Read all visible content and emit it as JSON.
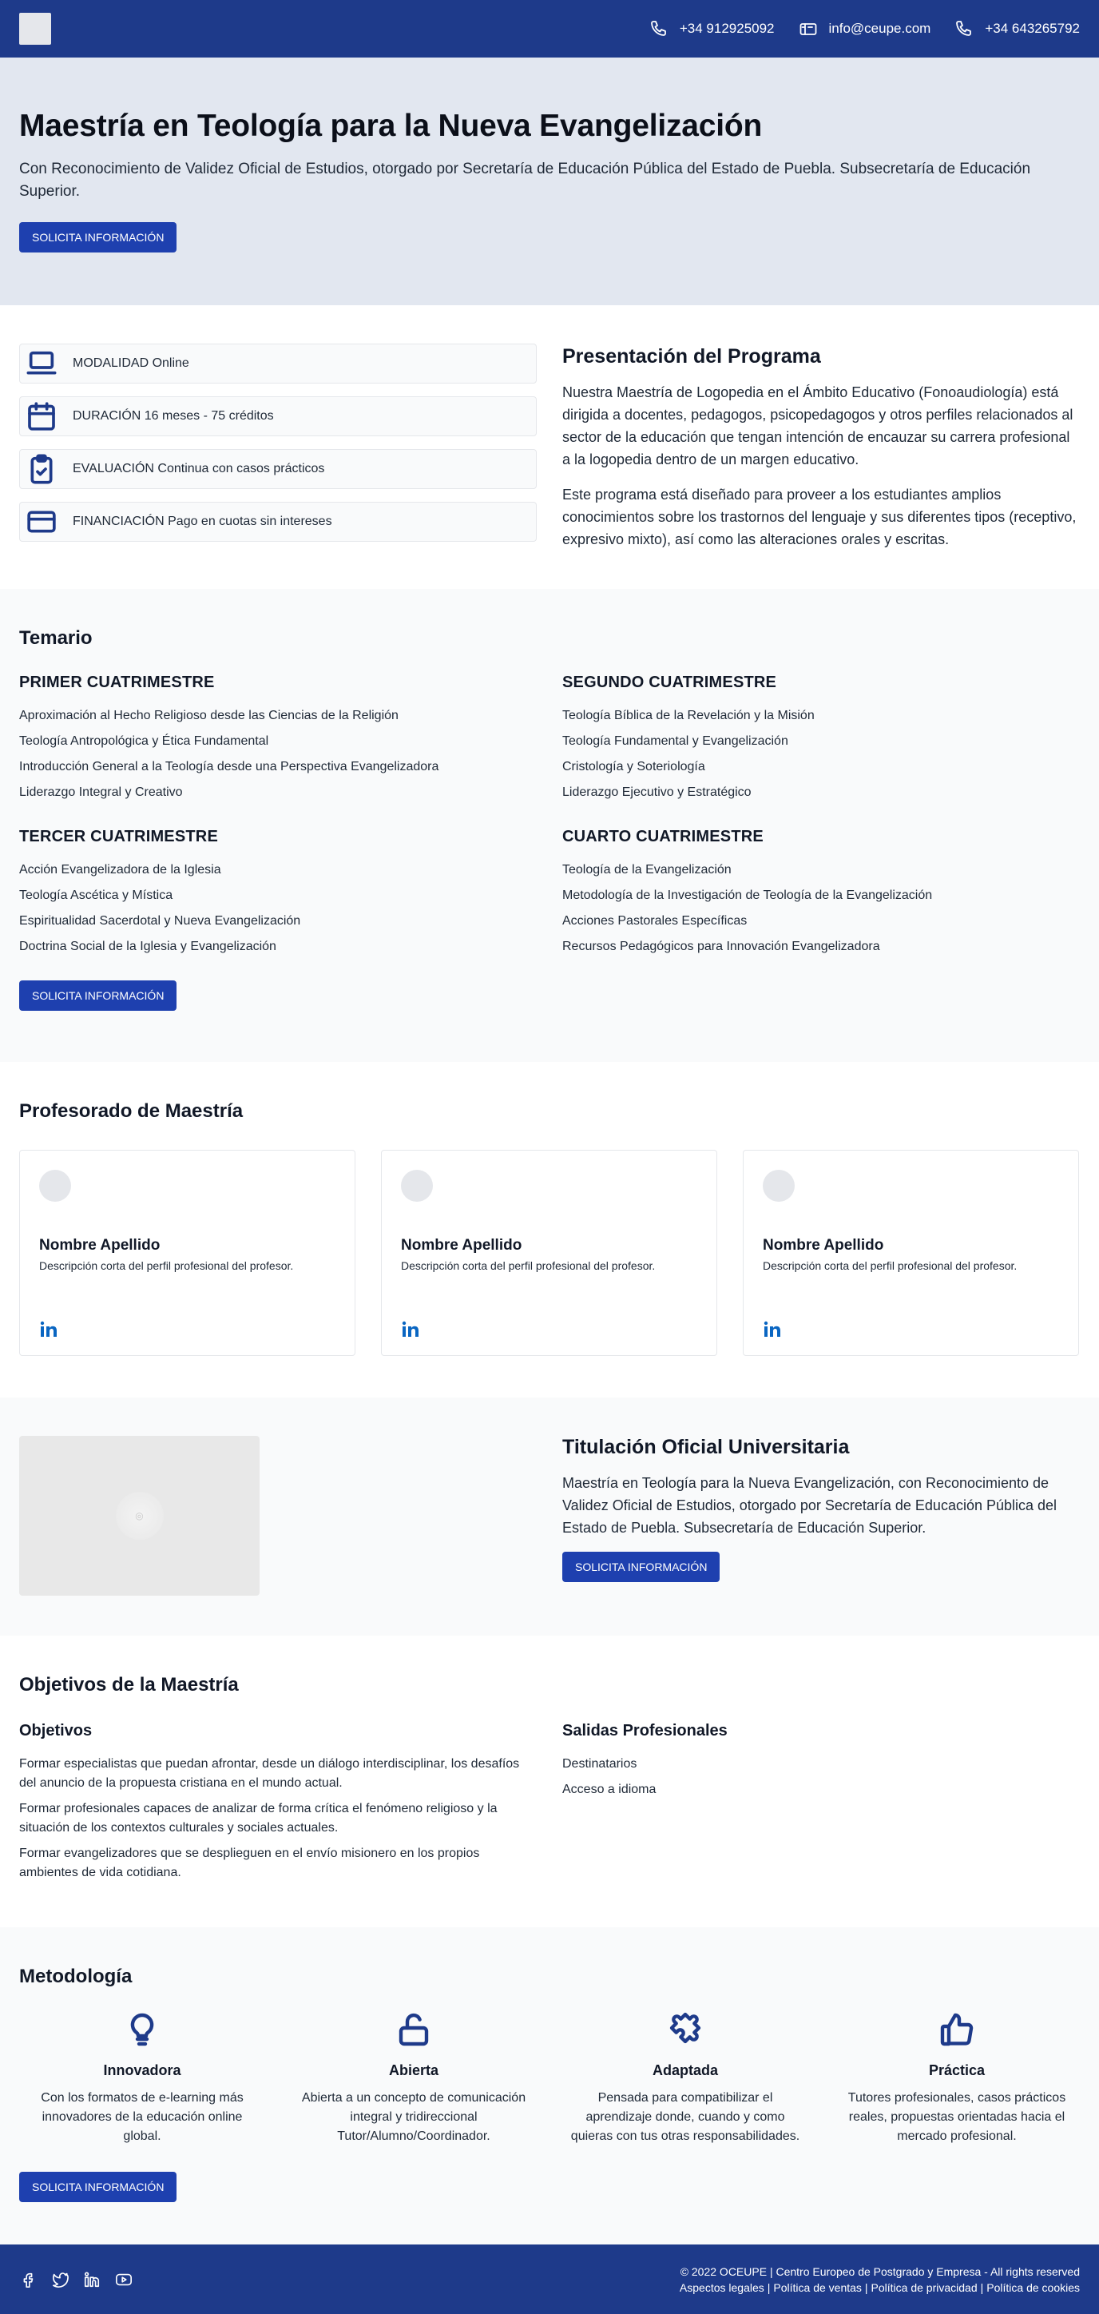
{
  "header": {
    "phone1": "+34 912925092",
    "email": "info@ceupe.com",
    "phone2": "+34 643265792"
  },
  "hero": {
    "title": "Maestría en Teología para la Nueva Evangelización",
    "subtitle": "Con Reconocimiento de Validez Oficial de Estudios, otorgado por Secretaría de Educación Pública del Estado de Puebla. Subsecretaría de Educación Superior.",
    "cta": "SOLICITA INFORMACIÓN"
  },
  "info": {
    "cards": [
      {
        "label": "MODALIDAD Online",
        "icon": "laptop-icon"
      },
      {
        "label": "DURACIÓN 16 meses - 75 créditos",
        "icon": "calendar-icon"
      },
      {
        "label": "EVALUACIÓN Continua con casos prácticos",
        "icon": "clipboard-check-icon"
      },
      {
        "label": "FINANCIACIÓN Pago en cuotas sin intereses",
        "icon": "credit-card-icon"
      }
    ],
    "title": "Presentación del Programa",
    "p1": "Nuestra Maestría de Logopedia en el Ámbito Educativo (Fonoaudiología) está dirigida a docentes, pedagogos, psicopedagogos y otros perfiles relacionados al sector de la educación que tengan intención de encauzar su carrera profesional a la logopedia dentro de un margen educativo.",
    "p2": "Este programa está diseñado para proveer a los estudiantes amplios conocimientos sobre los trastornos del lenguaje y sus diferentes tipos (receptivo, expresivo mixto), así como las alteraciones orales y escritas."
  },
  "temario": {
    "title": "Temario",
    "semesters": [
      {
        "title": "PRIMER CUATRIMESTRE",
        "items": [
          "Aproximación al Hecho Religioso desde las Ciencias de la Religión",
          "Teología Antropológica y Ética Fundamental",
          "Introducción General a la Teología desde una Perspectiva Evangelizadora",
          "Liderazgo Integral y Creativo"
        ]
      },
      {
        "title": "SEGUNDO CUATRIMESTRE",
        "items": [
          "Teología Bíblica de la Revelación y la Misión",
          "Teología Fundamental y Evangelización",
          "Cristología y Soteriología",
          "Liderazgo Ejecutivo y Estratégico"
        ]
      },
      {
        "title": "TERCER CUATRIMESTRE",
        "items": [
          "Acción Evangelizadora de la Iglesia",
          "Teología Ascética y Mística",
          "Espiritualidad Sacerdotal y Nueva Evangelización",
          "Doctrina Social de la Iglesia y Evangelización"
        ]
      },
      {
        "title": "CUARTO CUATRIMESTRE",
        "items": [
          "Teología de la Evangelización",
          "Metodología de la Investigación de Teología de la Evangelización",
          "Acciones Pastorales Específicas",
          "Recursos Pedagógicos para Innovación Evangelizadora"
        ]
      }
    ],
    "cta": "SOLICITA INFORMACIÓN"
  },
  "profesorado": {
    "title": "Profesorado de Maestría",
    "cards": [
      {
        "name": "Nombre Apellido",
        "desc": "Descripción corta del perfil profesional del profesor."
      },
      {
        "name": "Nombre Apellido",
        "desc": "Descripción corta del perfil profesional del profesor."
      },
      {
        "name": "Nombre Apellido",
        "desc": "Descripción corta del perfil profesional del profesor."
      }
    ]
  },
  "titulacion": {
    "title": "Titulación Oficial Universitaria",
    "text": "Maestría en Teología para la Nueva Evangelización, con Reconocimiento de Validez Oficial de Estudios, otorgado por Secretaría de Educación Pública del Estado de Puebla. Subsecretaría de Educación Superior.",
    "cta": "SOLICITA INFORMACIÓN"
  },
  "objetivos": {
    "title": "Objetivos de la Maestría",
    "col1_title": "Objetivos",
    "col1_items": [
      "Formar especialistas que puedan afrontar, desde un diálogo interdisciplinar, los desafíos del anuncio de la propuesta cristiana en el mundo actual.",
      "Formar profesionales capaces de analizar de forma crítica el fenómeno religioso y la situación de los contextos culturales y sociales actuales.",
      "Formar evangelizadores que se desplieguen en el envío misionero en los propios ambientes de vida cotidiana."
    ],
    "col2_title": "Salidas Profesionales",
    "col2_items": [
      "Destinatarios",
      "Acceso a idioma"
    ]
  },
  "metodologia": {
    "title": "Metodología",
    "items": [
      {
        "title": "Innovadora",
        "text": "Con los formatos de e-learning más innovadores de la educación online global.",
        "icon": "lightbulb-icon"
      },
      {
        "title": "Abierta",
        "text": "Abierta a un concepto de comunicación integral y tridireccional Tutor/Alumno/Coordinador.",
        "icon": "lock-open-icon"
      },
      {
        "title": "Adaptada",
        "text": "Pensada para compatibilizar el aprendizaje donde, cuando y como quieras con tus otras responsabilidades.",
        "icon": "puzzle-icon"
      },
      {
        "title": "Práctica",
        "text": "Tutores profesionales, casos prácticos reales, propuestas orientadas hacia el mercado profesional.",
        "icon": "thumbs-up-icon"
      }
    ],
    "cta": "SOLICITA INFORMACIÓN"
  },
  "footer": {
    "copyright": "© 2022 OCEUPE | Centro Europeo de Postgrado y Empresa - All rights reserved",
    "links": [
      "Aspectos legales",
      "Política de ventas",
      "Política de privacidad",
      "Política de cookies"
    ],
    "separator": "|"
  },
  "colors": {
    "primary": "#1e3a8a",
    "button": "#1e40af",
    "hero_bg": "#e2e7f0",
    "section_alt": "#f9fafb"
  }
}
